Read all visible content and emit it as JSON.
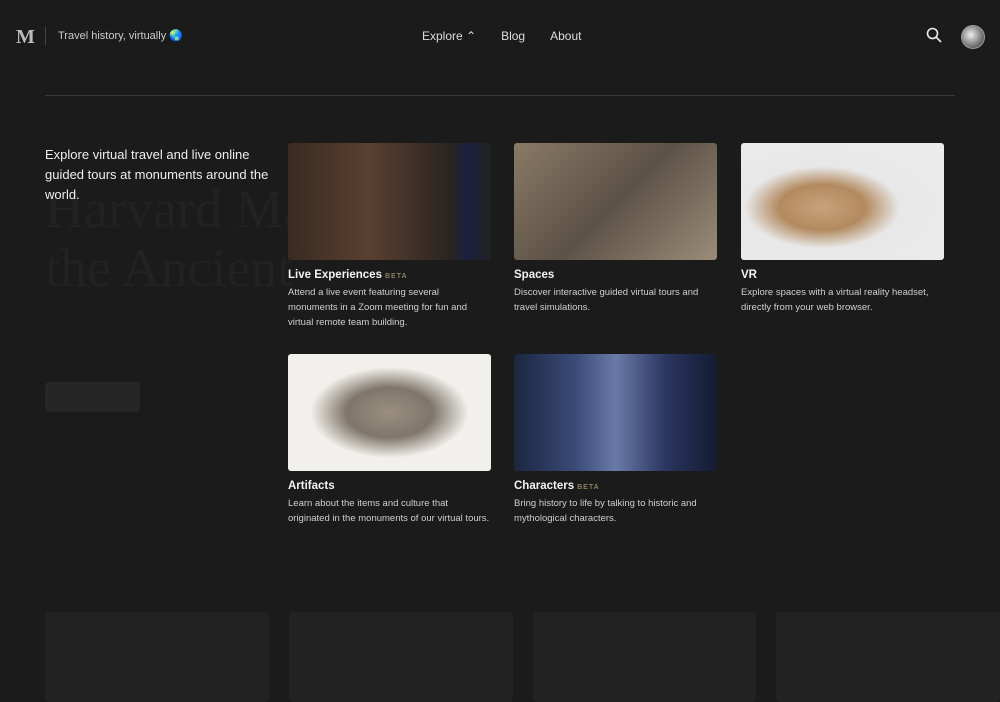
{
  "header": {
    "logo": "M",
    "tagline": "Travel history, virtually 🌏",
    "nav": [
      "Explore ⌃",
      "Blog",
      "About"
    ]
  },
  "intro": "Explore virtual travel and live online guided tours at monuments around the world.",
  "cards": [
    {
      "title": "Live Experiences",
      "badge": "BETA",
      "desc": "Attend a live event featuring several monuments in a Zoom meeting for fun and virtual remote team building."
    },
    {
      "title": "Spaces",
      "badge": "",
      "desc": "Discover interactive guided virtual tours and travel simulations."
    },
    {
      "title": "VR",
      "badge": "",
      "desc": "Explore spaces with a virtual reality headset, directly from your web browser."
    },
    {
      "title": "Artifacts",
      "badge": "",
      "desc": "Learn about the items and culture that originated in the monuments of our virtual tours."
    },
    {
      "title": "Characters",
      "badge": "BETA",
      "desc": "Bring history to life by talking to historic and mythological characters."
    }
  ]
}
